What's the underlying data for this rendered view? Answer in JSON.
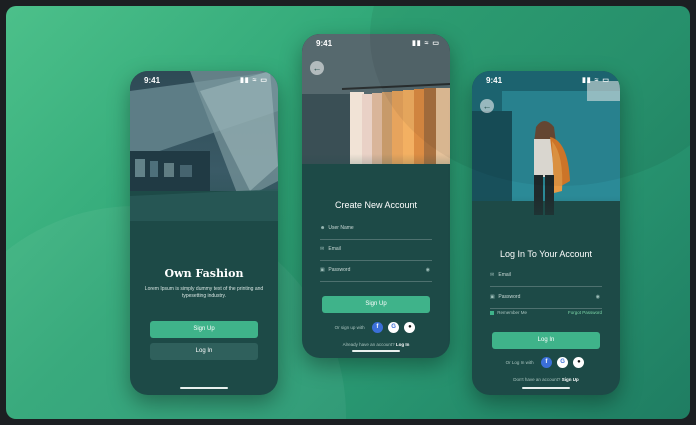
{
  "status_bar": {
    "time": "9:41",
    "icons": "▮▮ ≈ ▭"
  },
  "screen1": {
    "brand": "Own Fashion",
    "description": "Lorem Ipsum is simply dummy text of the printing and typesetting industry.",
    "signup_label": "Sign Up",
    "login_label": "Log In"
  },
  "screen2": {
    "title": "Create New Account",
    "username_placeholder": "User Name",
    "email_placeholder": "Email",
    "password_placeholder": "Password",
    "signup_label": "Sign Up",
    "social_label": "Or sign up with",
    "footer_text": "Already have an account?",
    "footer_link": "Log In"
  },
  "screen3": {
    "title": "Log In To Your Account",
    "email_placeholder": "Email",
    "password_value": "Password",
    "remember_label": "Remember Me",
    "forgot_label": "Forgot Password",
    "login_label": "Log In",
    "social_label": "Or Log In with",
    "footer_text": "Don't have an account?",
    "footer_link": "Sign Up"
  },
  "icons": {
    "back": "←",
    "user": "👤",
    "mail": "✉",
    "lock": "🔒",
    "eye": "👁",
    "facebook": "f",
    "google": "G",
    "apple": ""
  }
}
